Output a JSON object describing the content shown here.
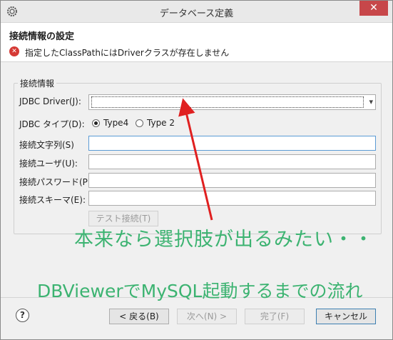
{
  "window": {
    "title": "データベース定義",
    "close_label": "✕"
  },
  "header": {
    "title": "接続情報の設定",
    "error_message": "指定したClassPathにはDriverクラスが存在しません"
  },
  "group": {
    "label": "接続情報",
    "driver_label": "JDBC Driver(J):",
    "driver_value": "",
    "type_label": "JDBC タイプ(D):",
    "type_options": [
      "Type4",
      "Type 2"
    ],
    "type_selected": "Type4",
    "url_label": "接続文字列(S)",
    "user_label": "接続ユーザ(U):",
    "password_label": "接続パスワード(P):",
    "schema_label": "接続スキーマ(E):",
    "test_button": "テスト接続(T)"
  },
  "footer": {
    "back_button": "< 戻る(B)",
    "next_button": "次へ(N) >",
    "finish_button": "完了(F)",
    "cancel_button": "キャンセル"
  },
  "annotations": {
    "note": "本来なら選択肢が出るみたい・・",
    "caption": "DBViewerでMySQL起動するまでの流れ",
    "color": "#3cb371",
    "arrow_color": "#e02020"
  }
}
